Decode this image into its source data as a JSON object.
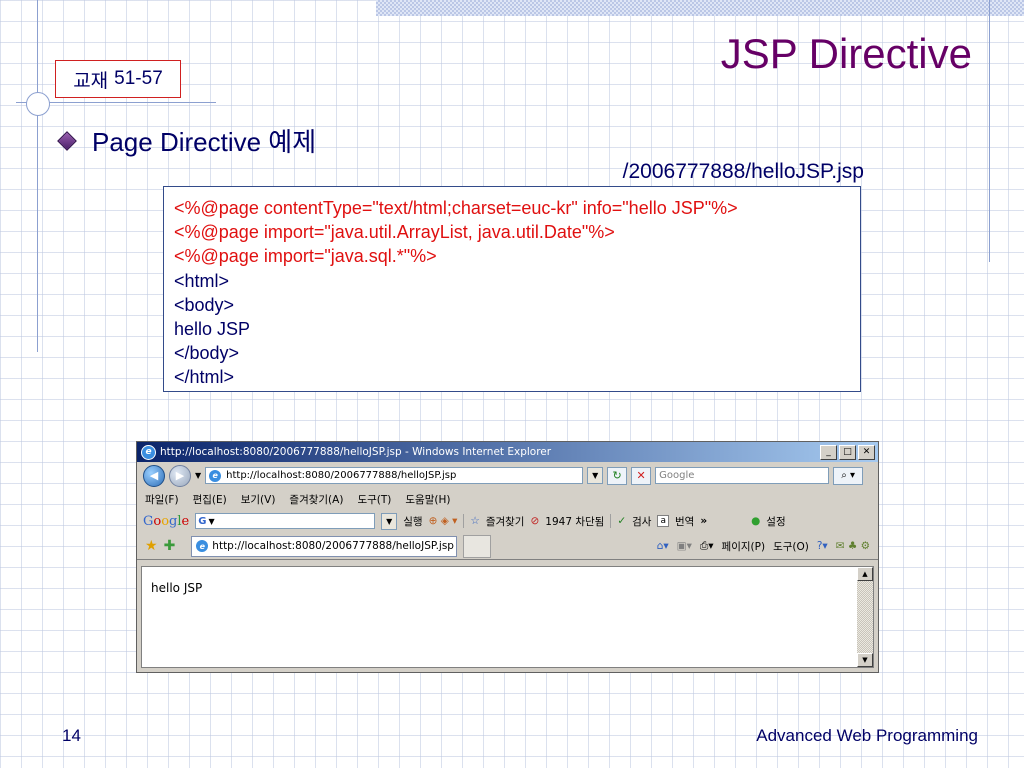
{
  "slide": {
    "title": "JSP Directive",
    "textbook": {
      "label": "교재",
      "pages": "51-57"
    },
    "bullet": "Page Directive 예제",
    "file_path": "/2006777888/helloJSP.jsp",
    "code_lines": [
      "<%@page contentType=\"text/html;charset=euc-kr\" info=\"hello JSP\"%>",
      "<%@page import=\"java.util.ArrayList, java.util.Date\"%>",
      "<%@page import=\"java.sql.*\"%>",
      "<html>",
      "<body>",
      "hello JSP",
      "</body>",
      "</html>"
    ],
    "page_number": "14",
    "footer": "Advanced Web Programming",
    "colors": {
      "title": "#660066",
      "text": "#000066",
      "code_directive": "#e01010",
      "box_border": "#d02020"
    }
  },
  "browser": {
    "window_title": "http://localhost:8080/2006777888/helloJSP.jsp - Windows Internet Explorer",
    "address": "http://localhost:8080/2006777888/helloJSP.jsp",
    "search_placeholder": "Google",
    "menu": [
      "파일(F)",
      "편집(E)",
      "보기(V)",
      "즐겨찾기(A)",
      "도구(T)",
      "도움말(H)"
    ],
    "google_toolbar": {
      "logo": "Google",
      "run": "실행",
      "bookmarks": "즐겨찾기",
      "blocked": "1947 차단됨",
      "check": "검사",
      "translate": "번역",
      "more": "»",
      "settings": "설정"
    },
    "tab_title": "http://localhost:8080/2006777888/helloJSP.jsp",
    "tools": {
      "page": "페이지(P)",
      "tools": "도구(O)"
    },
    "content": "hello JSP"
  }
}
